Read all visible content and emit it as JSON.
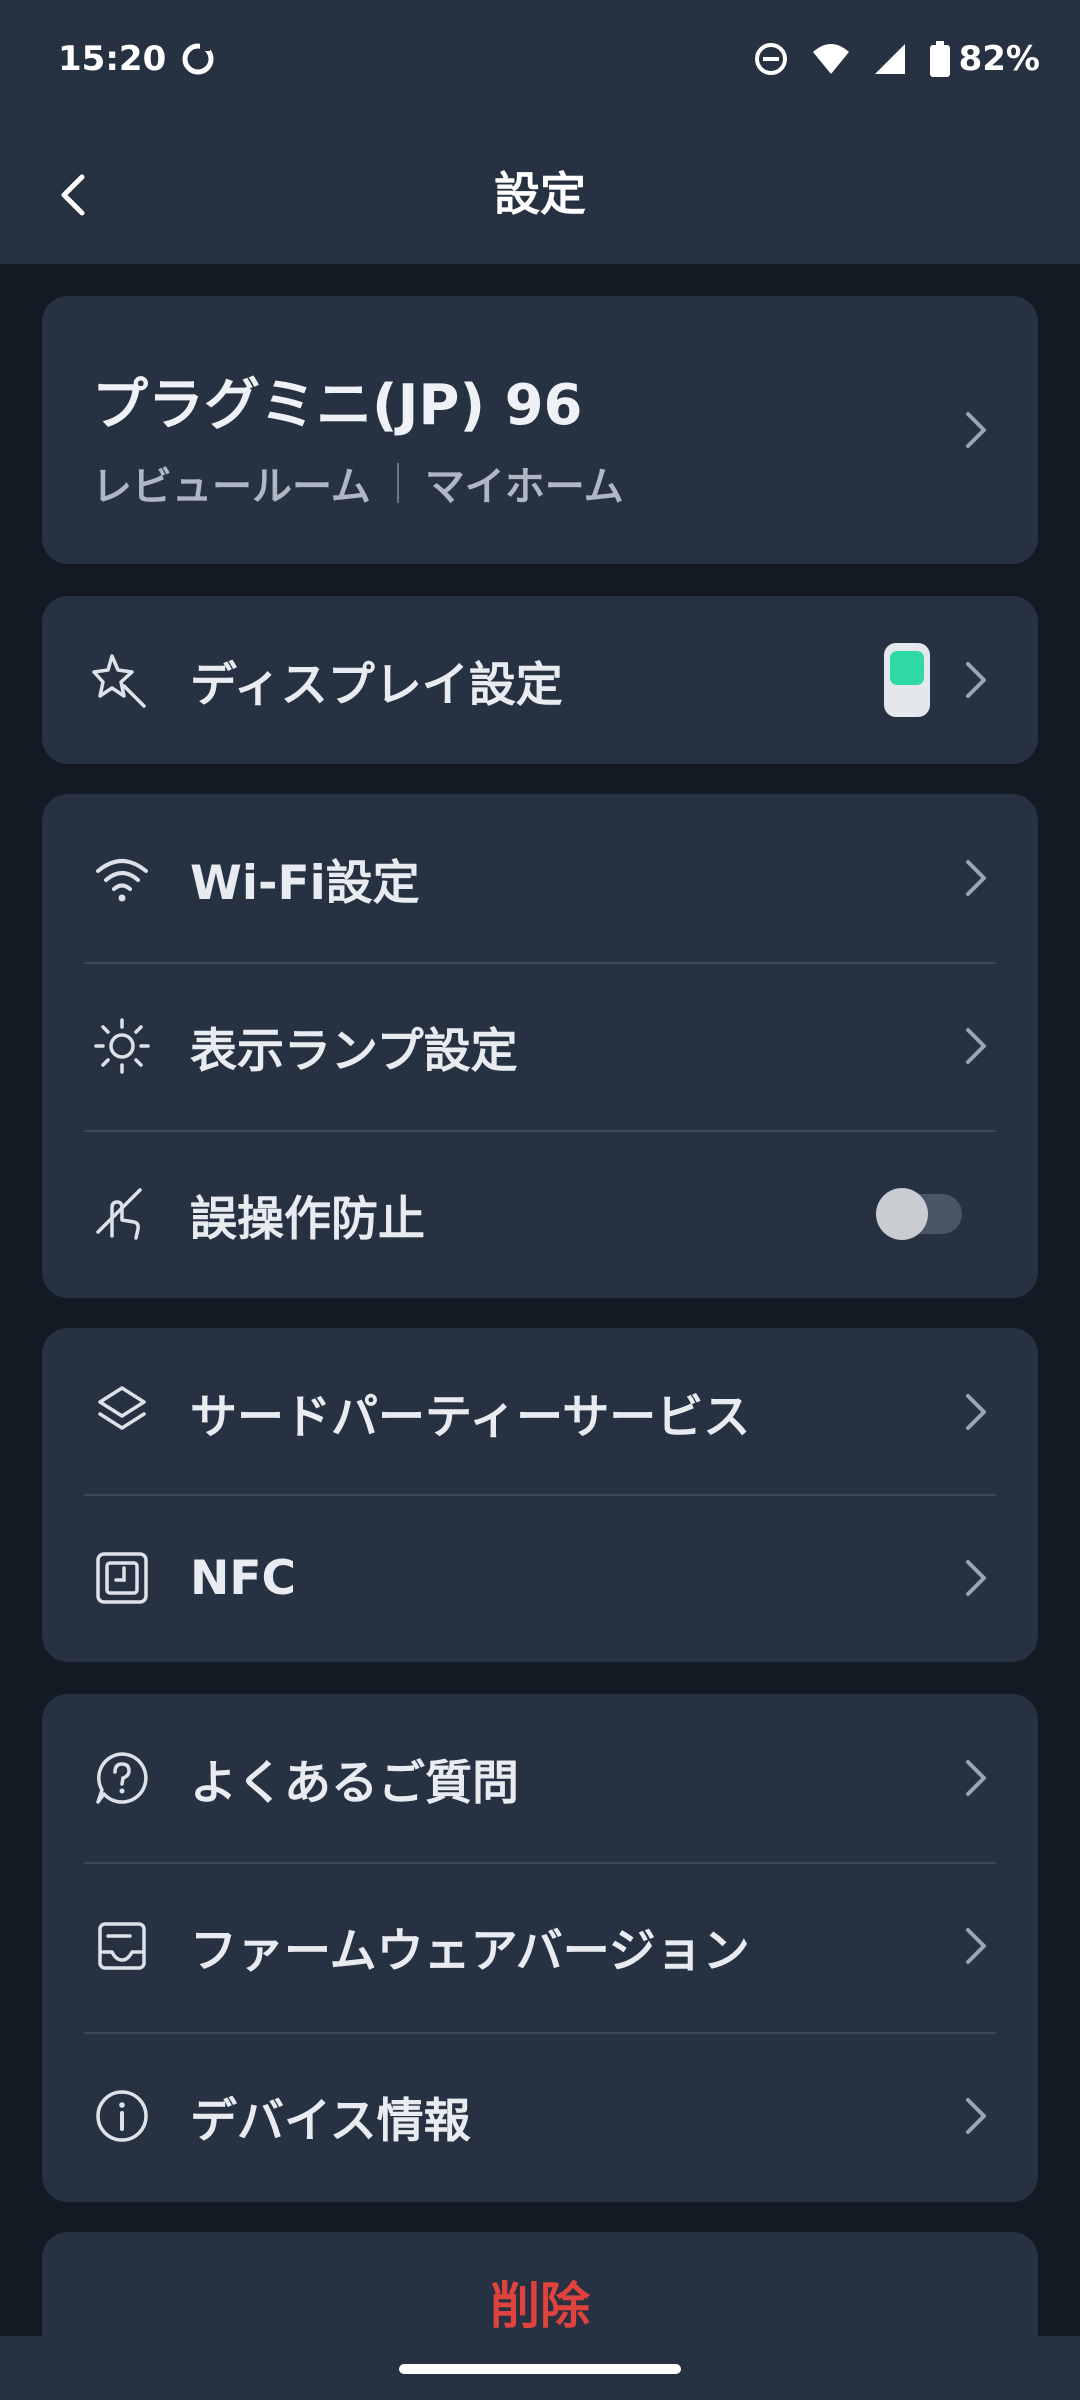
{
  "status": {
    "time": "15:20",
    "battery": "82%"
  },
  "header": {
    "title": "設定"
  },
  "device": {
    "name": "プラグミニ(JP) 96",
    "room": "レビュールーム",
    "home": "マイホーム"
  },
  "display_settings": {
    "label": "ディスプレイ設定",
    "thumb_color": "#2FD9A6"
  },
  "network_group": {
    "wifi": "Wi-Fi設定",
    "lamp": "表示ランプ設定",
    "child_lock": "誤操作防止",
    "child_lock_on": false
  },
  "services_group": {
    "third_party": "サードパーティーサービス",
    "nfc": "NFC"
  },
  "info_group": {
    "faq": "よくあるご質問",
    "firmware": "ファームウェアバージョン",
    "device_info": "デバイス情報"
  },
  "delete": {
    "label": "削除",
    "color": "#E0423E"
  },
  "colors": {
    "background": "#131A24",
    "card": "#263141",
    "accent": "#2FD9A6"
  }
}
